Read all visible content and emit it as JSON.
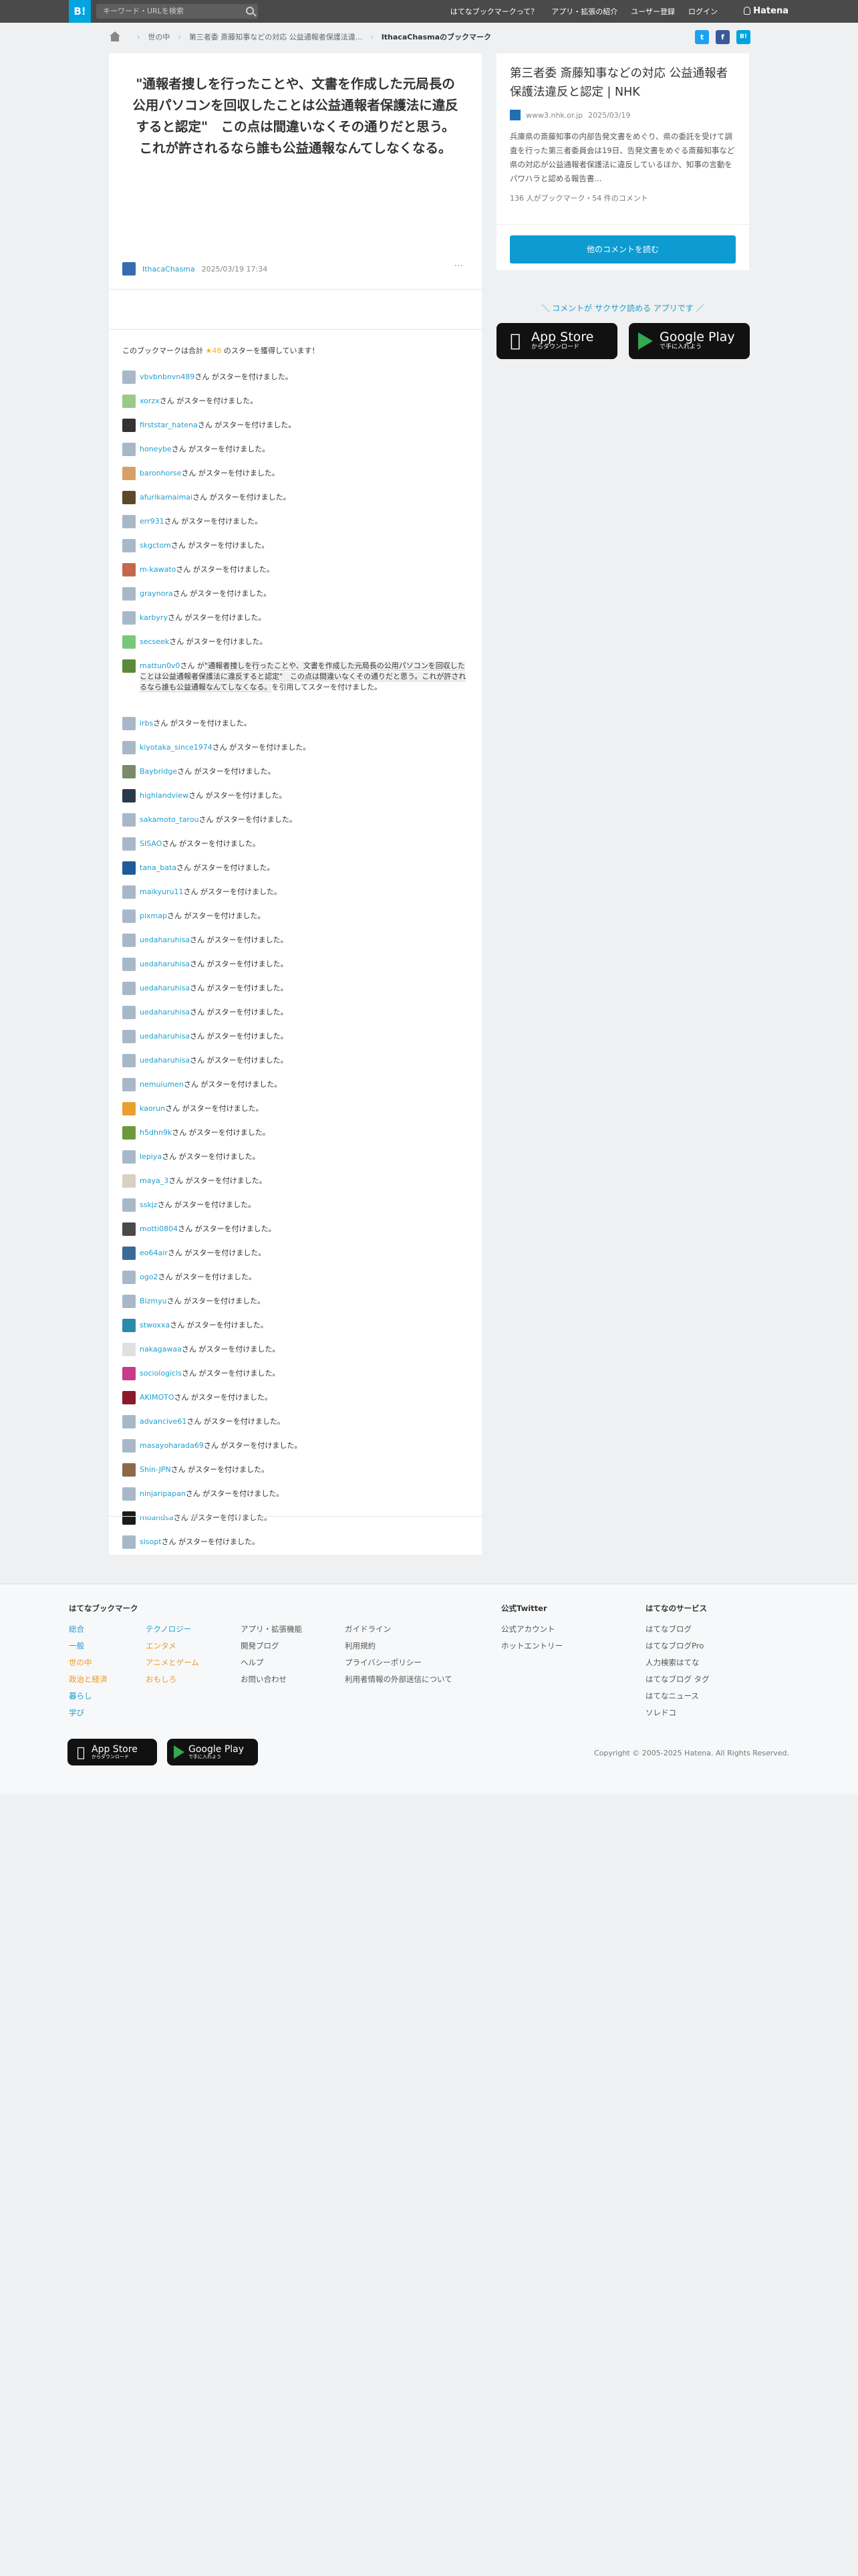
{
  "header": {
    "logo": "B!",
    "search_placeholder": "キーワード・URLを検索",
    "nav": [
      "はてなブックマークって？",
      "アプリ・拡張の紹介",
      "ユーザー登録",
      "ログイン"
    ],
    "brand": "Hatena"
  },
  "breadcrumb": {
    "items": [
      "世の中",
      "第三者委 斎藤知事などの対応 公益通報者保護法違..."
    ],
    "current": "IthacaChasmaのブックマーク"
  },
  "share": [
    "t",
    "f",
    "B!"
  ],
  "bookmark": {
    "comment": "\"通報者捜しを行ったことや、文書を作成した元局長の公用パソコンを回収したことは公益通報者保護法に違反すると認定\"　この点は間違いなくその通りだと思う。これが許されるなら誰も公益通報なんてしなくなる。",
    "user": "IthacaChasma",
    "timestamp": "2025/03/19 17:34",
    "more": "···"
  },
  "stars": {
    "summary_prefix": "このブックマークは合計",
    "star_glyph": "★",
    "count": "48",
    "summary_suffix": "のスターを獲得しています！",
    "suffix": "さん がスターを付けました。",
    "quote_prefix": "さん が",
    "quote_text": "\"通報者捜しを行ったことや、文書を作成した元局長の公用パソコンを回収したことは公益通報者保護法に違反すると認定\"　この点は間違いなくその通りだと思う。これが許されるなら誰も公益通報なんてしなくなる。",
    "quote_suffix": "を引用してスターを付けました。",
    "users": [
      {
        "name": "vbvbnbnvn489",
        "color": "#a8b8c8"
      },
      {
        "name": "xorzx",
        "color": "#9ac98a"
      },
      {
        "name": "firststar_hatena",
        "color": "#333333"
      },
      {
        "name": "honeybe",
        "color": "#a8b8c8"
      },
      {
        "name": "baronhorse",
        "color": "#d9a066"
      },
      {
        "name": "afurikamaimai",
        "color": "#5a4a2a"
      },
      {
        "name": "err931",
        "color": "#a8b8c8"
      },
      {
        "name": "skgctom",
        "color": "#a8b8c8"
      },
      {
        "name": "m-kawato",
        "color": "#c7664f"
      },
      {
        "name": "graynora",
        "color": "#a8b8c8"
      },
      {
        "name": "karbyry",
        "color": "#a8b8c8"
      },
      {
        "name": "secseek",
        "color": "#78c878"
      },
      {
        "name": "mattun0v0",
        "color": "#5a8a3a",
        "quote": true
      },
      {
        "name": "irbs",
        "color": "#a8b8c8"
      },
      {
        "name": "kiyotaka_since1974",
        "color": "#a8b8c8"
      },
      {
        "name": "Baybridge",
        "color": "#7a8a6a"
      },
      {
        "name": "highlandview",
        "color": "#2a3a4a"
      },
      {
        "name": "sakamoto_tarou",
        "color": "#a8b8c8"
      },
      {
        "name": "SISAO",
        "color": "#a8b8c8"
      },
      {
        "name": "tana_bata",
        "color": "#1f5a9a"
      },
      {
        "name": "maikyuru11",
        "color": "#a8b8c8"
      },
      {
        "name": "pixmap",
        "color": "#a8b8c8"
      },
      {
        "name": "uedaharuhisa",
        "color": "#a8b8c8"
      },
      {
        "name": "uedaharuhisa",
        "color": "#a8b8c8"
      },
      {
        "name": "uedaharuhisa",
        "color": "#a8b8c8"
      },
      {
        "name": "uedaharuhisa",
        "color": "#a8b8c8"
      },
      {
        "name": "uedaharuhisa",
        "color": "#a8b8c8"
      },
      {
        "name": "uedaharuhisa",
        "color": "#a8b8c8"
      },
      {
        "name": "nemuiumen",
        "color": "#a8b8c8"
      },
      {
        "name": "kaorun",
        "color": "#e8a030"
      },
      {
        "name": "h5dhn9k",
        "color": "#6a9a3a"
      },
      {
        "name": "lepiya",
        "color": "#a8b8c8"
      },
      {
        "name": "maya_3",
        "color": "#d8d0c0"
      },
      {
        "name": "sskjz",
        "color": "#a8b8c8"
      },
      {
        "name": "motti0804",
        "color": "#4a4a4a"
      },
      {
        "name": "eo64air",
        "color": "#3a6a9a"
      },
      {
        "name": "ogo2",
        "color": "#a8b8c8"
      },
      {
        "name": "Bizmyu",
        "color": "#a8b8c8"
      },
      {
        "name": "stwoxxa",
        "color": "#2a8aaa"
      },
      {
        "name": "nakagawaa",
        "color": "#e0e0e0"
      },
      {
        "name": "sociologicls",
        "color": "#c83a8a"
      },
      {
        "name": "AKIMOTO",
        "color": "#8a1a2a"
      },
      {
        "name": "advancive61",
        "color": "#a8b8c8"
      },
      {
        "name": "masayoharada69",
        "color": "#a8b8c8"
      },
      {
        "name": "Shin-JPN",
        "color": "#8a6a4a"
      },
      {
        "name": "ninjaripapan",
        "color": "#a8b8c8"
      },
      {
        "name": "moandsa",
        "color": "#1a1a1a"
      },
      {
        "name": "sisopt",
        "color": "#a8b8c8"
      }
    ]
  },
  "entry": {
    "title": "第三者委 斎藤知事などの対応 公益通報者保護法違反と認定 | NHK",
    "domain": "www3.nhk.or.jp",
    "date": "2025/03/19",
    "description": "兵庫県の斎藤知事の内部告発文書をめぐり、県の委託を受けて調査を行った第三者委員会は19日、告発文書をめぐる斎藤知事など県の対応が公益通報者保護法に違反しているほか、知事の言動をパワハラと認める報告書...",
    "stats": "136 人がブックマーク・54 件のコメント",
    "button": "他のコメントを読む"
  },
  "app_promo": {
    "text": "＼ コメントが サクサク読める アプリです ／",
    "appstore_top": "App Store",
    "appstore_sub": "からダウンロード",
    "googleplay_top": "Google Play",
    "googleplay_sub": "で手に入れよう"
  },
  "footer": {
    "col1_title": "はてなブックマーク",
    "col1a": [
      "総合",
      "一般",
      "世の中",
      "政治と経済",
      "暮らし",
      "学び"
    ],
    "col1b": [
      "テクノロジー",
      "エンタメ",
      "アニメとゲーム",
      "おもしろ"
    ],
    "col1c": [
      "アプリ・拡張機能",
      "開発ブログ",
      "ヘルプ",
      "お問い合わせ"
    ],
    "col1d": [
      "ガイドライン",
      "利用規約",
      "プライバシーポリシー",
      "利用者情報の外部送信について"
    ],
    "col2_title": "公式Twitter",
    "col2": [
      "公式アカウント",
      "ホットエントリー"
    ],
    "col3_title": "はてなのサービス",
    "col3": [
      "はてなブログ",
      "はてなブログPro",
      "人力検索はてな",
      "はてなブログ タグ",
      "はてなニュース",
      "ソレドコ"
    ],
    "copyright": "Copyright © 2005-2025 Hatena. All Rights Reserved."
  }
}
